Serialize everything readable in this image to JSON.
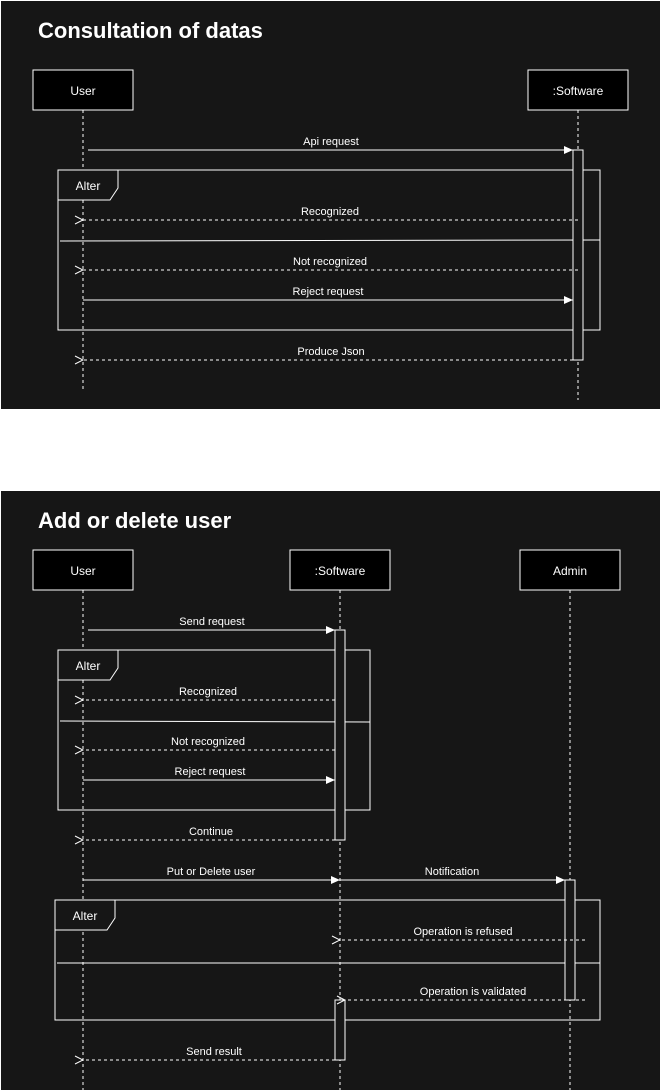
{
  "diagrams": [
    {
      "title": "Consultation of datas",
      "actors": [
        {
          "name": "User"
        },
        {
          "name": ":Software"
        }
      ],
      "frames": [
        {
          "label": "Alter"
        }
      ],
      "messages": [
        {
          "from": "User",
          "to": ":Software",
          "label": "Api request",
          "style": "solid"
        },
        {
          "from": ":Software",
          "to": "User",
          "label": "Recognized",
          "style": "dashed"
        },
        {
          "from": ":Software",
          "to": "User",
          "label": "Not recognized",
          "style": "dashed"
        },
        {
          "from": "User",
          "to": ":Software",
          "label": "Reject request",
          "style": "solid"
        },
        {
          "from": ":Software",
          "to": "User",
          "label": "Produce Json",
          "style": "dashed"
        }
      ]
    },
    {
      "title": "Add or delete user",
      "actors": [
        {
          "name": "User"
        },
        {
          "name": ":Software"
        },
        {
          "name": "Admin"
        }
      ],
      "frames": [
        {
          "label": "Alter"
        },
        {
          "label": "Alter"
        }
      ],
      "messages": [
        {
          "from": "User",
          "to": ":Software",
          "label": "Send request",
          "style": "solid"
        },
        {
          "from": ":Software",
          "to": "User",
          "label": "Recognized",
          "style": "dashed"
        },
        {
          "from": ":Software",
          "to": "User",
          "label": "Not recognized",
          "style": "dashed"
        },
        {
          "from": "User",
          "to": ":Software",
          "label": "Reject request",
          "style": "solid"
        },
        {
          "from": ":Software",
          "to": "User",
          "label": "Continue",
          "style": "dashed"
        },
        {
          "from": "User",
          "to": ":Software",
          "label": "Put or Delete user",
          "style": "solid"
        },
        {
          "from": ":Software",
          "to": "Admin",
          "label": "Notification",
          "style": "solid"
        },
        {
          "from": "Admin",
          "to": ":Software",
          "label": "Operation is refused",
          "style": "dashed"
        },
        {
          "from": "Admin",
          "to": ":Software",
          "label": "Operation is validated",
          "style": "dashed"
        },
        {
          "from": ":Software",
          "to": "User",
          "label": "Send result",
          "style": "dashed"
        }
      ]
    }
  ],
  "colors": {
    "panel": "#161616",
    "line": "#ffffff",
    "actor_fill": "#000000",
    "page": "#ffffff"
  }
}
